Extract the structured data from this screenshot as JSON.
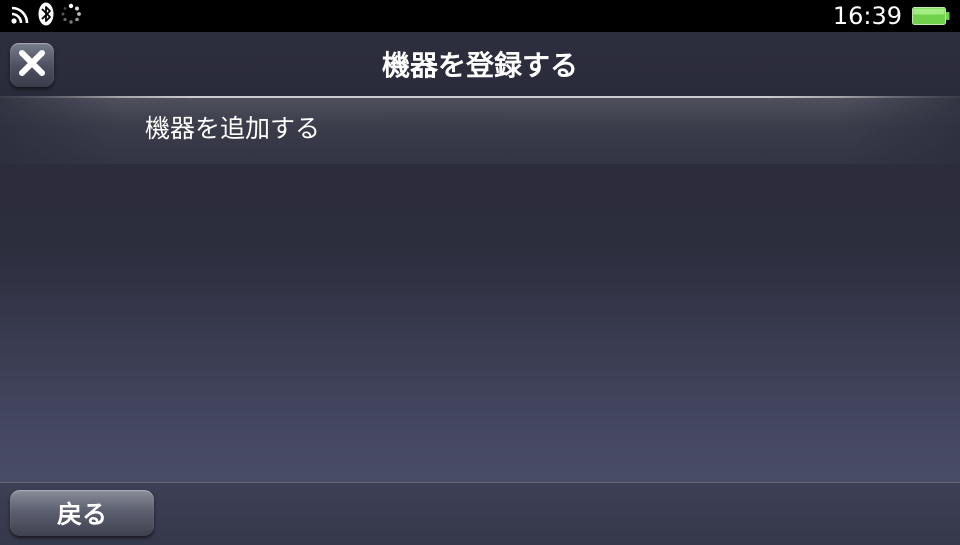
{
  "status_bar": {
    "time": "16:39",
    "icons": [
      "wifi-icon",
      "bluetooth-icon",
      "loading-spinner-icon"
    ],
    "battery_color": "#6fd24a"
  },
  "header": {
    "title": "機器を登録する",
    "close_icon": "close-icon"
  },
  "list": {
    "items": [
      {
        "label": "機器を追加する"
      }
    ]
  },
  "footer": {
    "back_label": "戻る"
  }
}
